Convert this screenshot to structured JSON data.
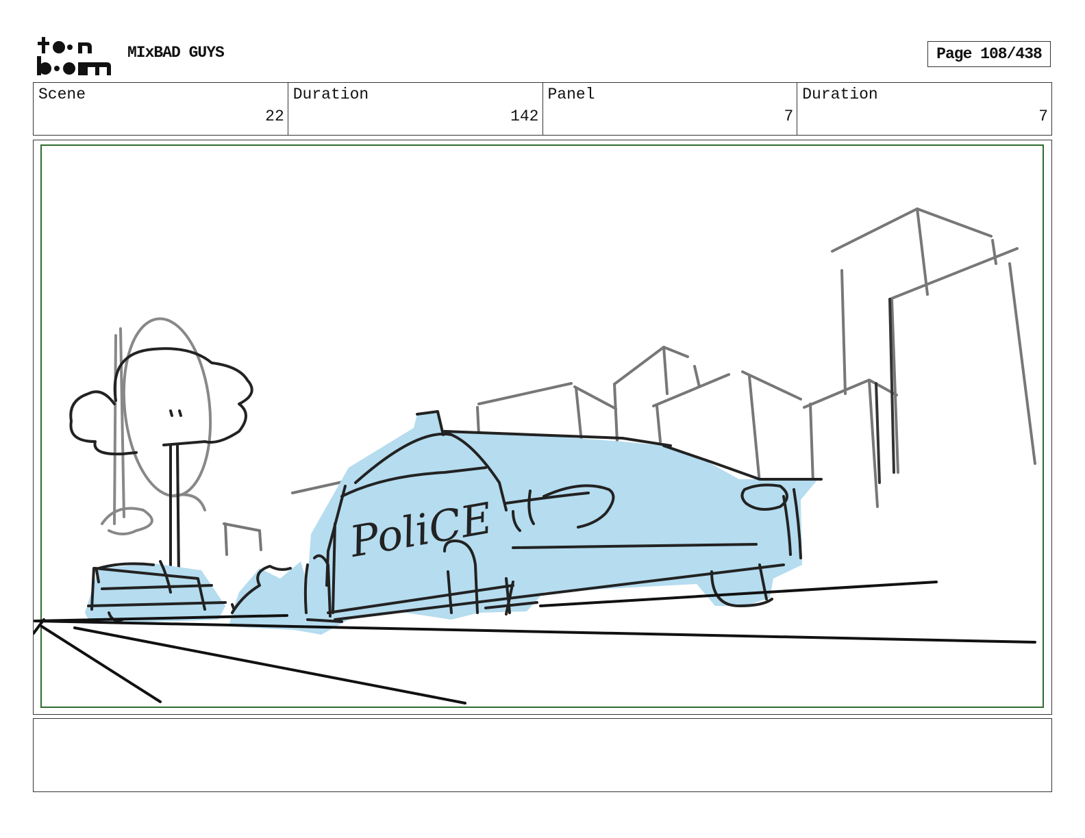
{
  "header": {
    "logo_icon": "toon-boom-logo",
    "project_title": "MIxBAD GUYS",
    "page_label": "Page 108/438"
  },
  "info": {
    "scene_label": "Scene",
    "scene_value": "22",
    "scene_duration_label": "Duration",
    "scene_duration_value": "142",
    "panel_label": "Panel",
    "panel_value": "7",
    "panel_duration_label": "Duration",
    "panel_duration_value": "7"
  },
  "panel": {
    "sketch_text": "PoliCE",
    "car_fill": "#b5dcef",
    "safe_area_color": "#2e6b2e"
  },
  "notes": {
    "text": ""
  }
}
